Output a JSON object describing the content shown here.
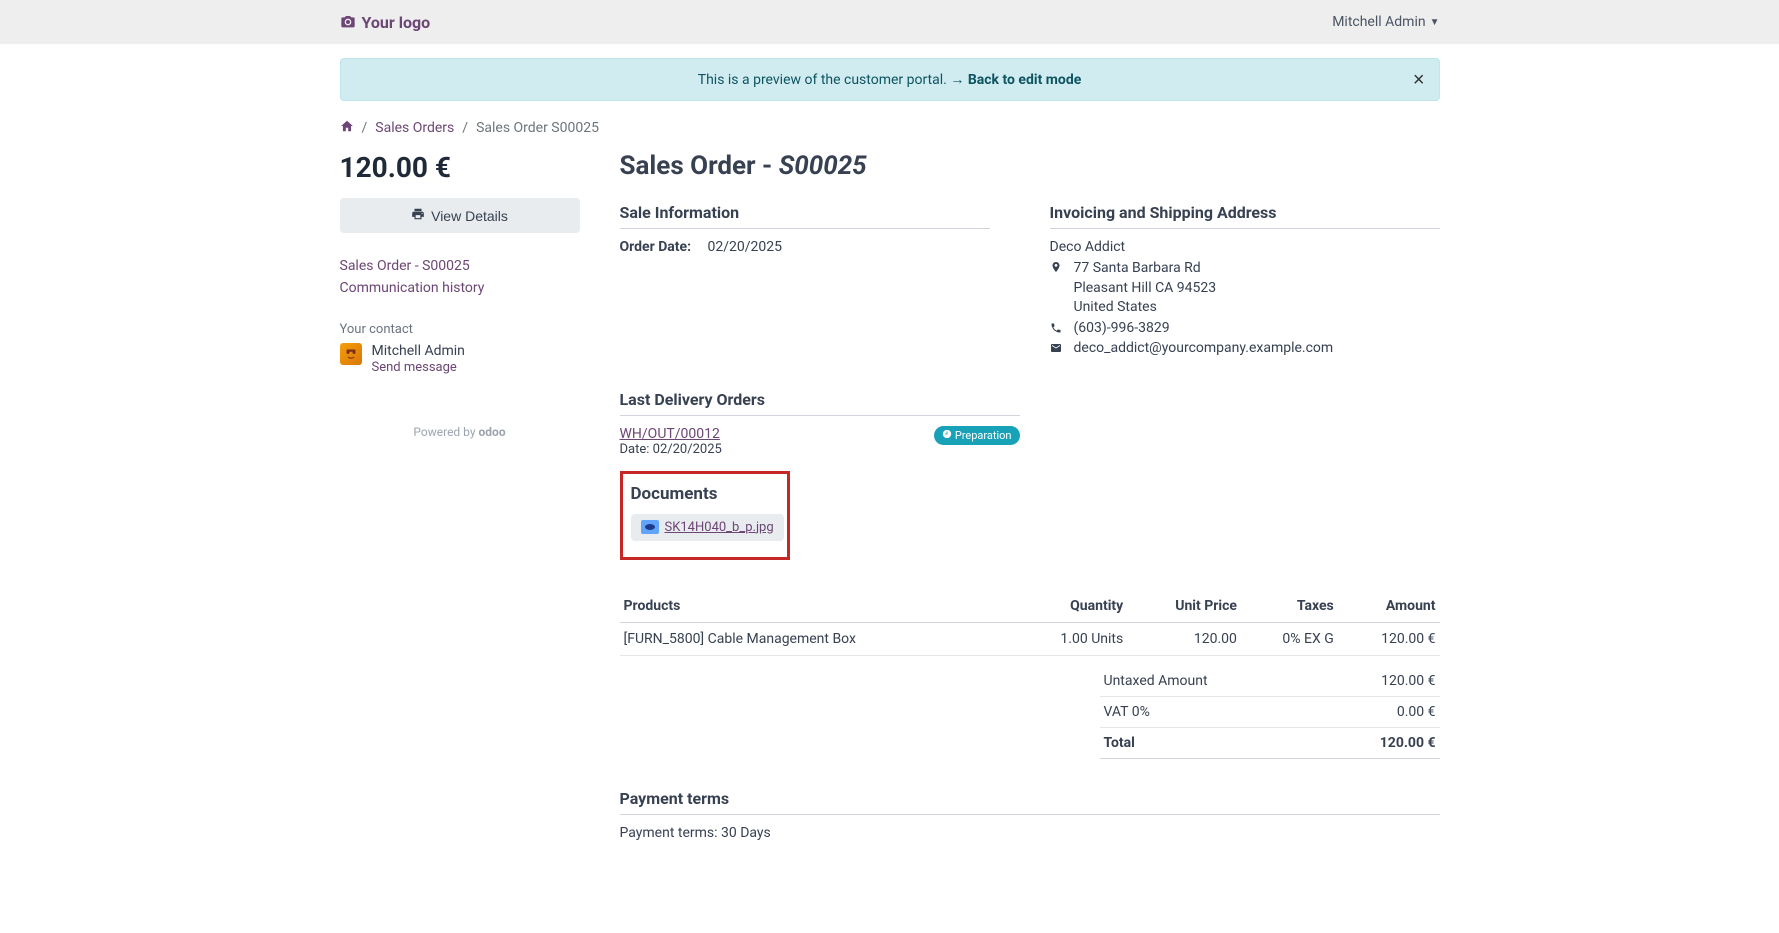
{
  "topbar": {
    "logo_text": "Your logo",
    "user_name": "Mitchell Admin"
  },
  "alert": {
    "text": "This is a preview of the customer portal. ",
    "link_text": "Back to edit mode"
  },
  "breadcrumb": {
    "sales_orders": "Sales Orders",
    "current": "Sales Order S00025"
  },
  "sidebar": {
    "price": "120.00 €",
    "view_details": "View Details",
    "link1": "Sales Order - S00025",
    "link2": "Communication history",
    "contact_label": "Your contact",
    "contact_name": "Mitchell Admin",
    "send_message": "Send message",
    "powered_by": "Powered by",
    "odoo": "odoo"
  },
  "page": {
    "title_prefix": "Sales Order - ",
    "title_ref": "S00025"
  },
  "sale_info": {
    "heading": "Sale Information",
    "order_date_label": "Order Date:",
    "order_date": "02/20/2025"
  },
  "address": {
    "heading": "Invoicing and Shipping Address",
    "name": "Deco Addict",
    "street": "77 Santa Barbara Rd",
    "city": "Pleasant Hill CA 94523",
    "country": "United States",
    "phone": "(603)-996-3829",
    "email": "deco_addict@yourcompany.example.com"
  },
  "delivery": {
    "heading": "Last Delivery Orders",
    "ref": "WH/OUT/00012",
    "date_label": "Date:",
    "date": "02/20/2025",
    "badge": "Preparation"
  },
  "documents": {
    "heading": "Documents",
    "file": "SK14H040_b_p.jpg"
  },
  "table": {
    "h_products": "Products",
    "h_quantity": "Quantity",
    "h_unit_price": "Unit Price",
    "h_taxes": "Taxes",
    "h_amount": "Amount",
    "row": {
      "product": "[FURN_5800] Cable Management Box",
      "quantity": "1.00 Units",
      "unit_price": "120.00",
      "taxes": "0% EX G",
      "amount": "120.00 €"
    }
  },
  "totals": {
    "untaxed_label": "Untaxed Amount",
    "untaxed": "120.00 €",
    "vat_label": "VAT 0%",
    "vat": "0.00 €",
    "total_label": "Total",
    "total": "120.00 €"
  },
  "payment": {
    "heading": "Payment terms",
    "text": "Payment terms: 30 Days"
  }
}
